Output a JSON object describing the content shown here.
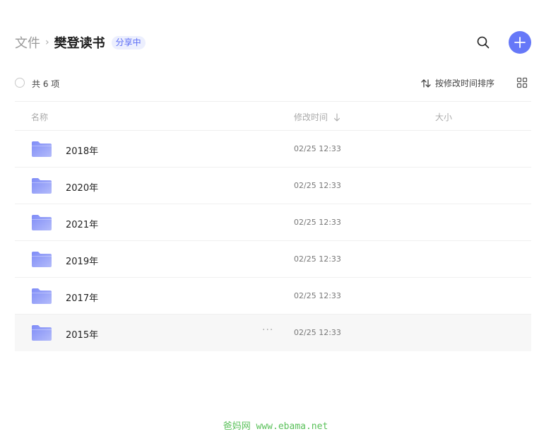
{
  "breadcrumb": {
    "root": "文件",
    "separator": "›",
    "current": "樊登读书",
    "badge": "分享中"
  },
  "toolbar": {
    "count": "共 6 项",
    "sort_label": "按修改时间排序"
  },
  "table": {
    "headers": {
      "name": "名称",
      "mtime": "修改时间",
      "size": "大小"
    },
    "rows": [
      {
        "name": "2018年",
        "mtime": "02/25 12:33"
      },
      {
        "name": "2020年",
        "mtime": "02/25 12:33"
      },
      {
        "name": "2021年",
        "mtime": "02/25 12:33"
      },
      {
        "name": "2019年",
        "mtime": "02/25 12:33"
      },
      {
        "name": "2017年",
        "mtime": "02/25 12:33"
      },
      {
        "name": "2015年",
        "mtime": "02/25 12:33",
        "more": "···"
      }
    ]
  },
  "watermark": "爸妈网 www.ebama.net",
  "colors": {
    "accent": "#6678f8",
    "folder": "#8b97f8",
    "badge_bg": "#eceffe",
    "watermark": "#5ac15a"
  },
  "icons": {
    "search": "search-icon",
    "add": "plus-icon",
    "sort": "sort-arrows-icon",
    "view": "grid-view-icon",
    "folder": "folder-icon"
  }
}
